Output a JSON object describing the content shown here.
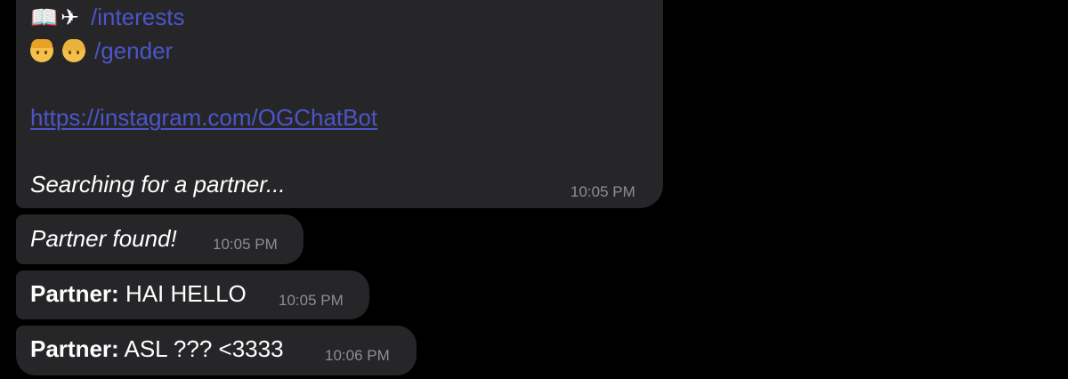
{
  "messages": {
    "intro": {
      "interests_icons": "📖 ✈",
      "interests_cmd": "/interests",
      "gender_cmd": "/gender",
      "link": "https://instagram.com/OGChatBot",
      "status": "Searching for a partner...",
      "time": "10:05 PM"
    },
    "found": {
      "text": "Partner found!",
      "time": "10:05 PM"
    },
    "msg1": {
      "sender": "Partner:",
      "text": "HAI HELLO",
      "time": "10:05 PM"
    },
    "msg2": {
      "sender": "Partner:",
      "text": "ASL ??? <3333",
      "time": "10:06 PM"
    }
  },
  "colors": {
    "background": "#000000",
    "bubble": "#262628",
    "command": "#4b55c8",
    "timestamp": "#8e8e93"
  },
  "icons": [
    "open-book-icon",
    "airplane-icon",
    "boy-face-icon",
    "girl-face-icon"
  ]
}
